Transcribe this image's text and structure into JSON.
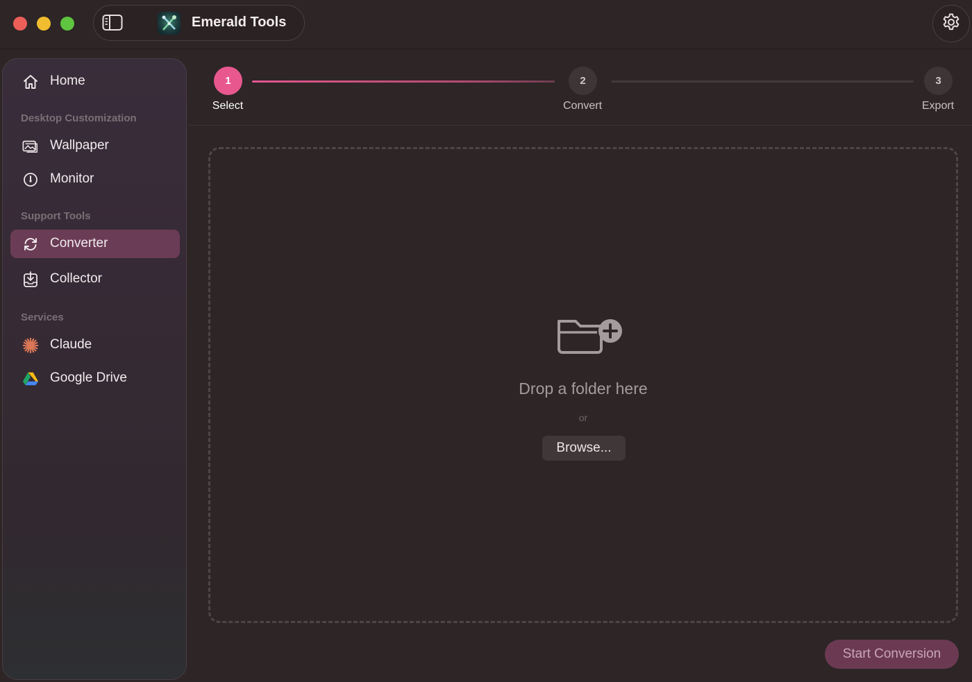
{
  "app": {
    "title": "Emerald Tools"
  },
  "titlebar": {
    "sidebar_toggle_icon": "sidebar-toggle-icon",
    "settings_icon": "gear-icon"
  },
  "sidebar": {
    "home": {
      "label": "Home",
      "icon": "home-icon"
    },
    "sections": [
      {
        "title": "Desktop Customization",
        "items": [
          {
            "label": "Wallpaper",
            "icon": "photo-icon"
          },
          {
            "label": "Monitor",
            "icon": "gauge-icon"
          }
        ]
      },
      {
        "title": "Support Tools",
        "items": [
          {
            "label": "Converter",
            "icon": "refresh-icon",
            "active": true
          },
          {
            "label": "Collector",
            "icon": "download-tray-icon"
          }
        ]
      },
      {
        "title": "Services",
        "items": [
          {
            "label": "Claude",
            "icon": "claude-spark-icon"
          },
          {
            "label": "Google Drive",
            "icon": "google-drive-icon"
          }
        ]
      }
    ]
  },
  "stepper": {
    "steps": [
      {
        "number": "1",
        "label": "Select",
        "active": true
      },
      {
        "number": "2",
        "label": "Convert",
        "active": false
      },
      {
        "number": "3",
        "label": "Export",
        "active": false
      }
    ]
  },
  "dropzone": {
    "icon": "folder-plus-icon",
    "title": "Drop a folder here",
    "or_text": "or",
    "browse_label": "Browse..."
  },
  "actions": {
    "start_label": "Start Conversion"
  },
  "colors": {
    "accent": "#e8588f",
    "active_nav": "#6b3c55",
    "background": "#2d2526",
    "start_button": "#6b3a52"
  }
}
